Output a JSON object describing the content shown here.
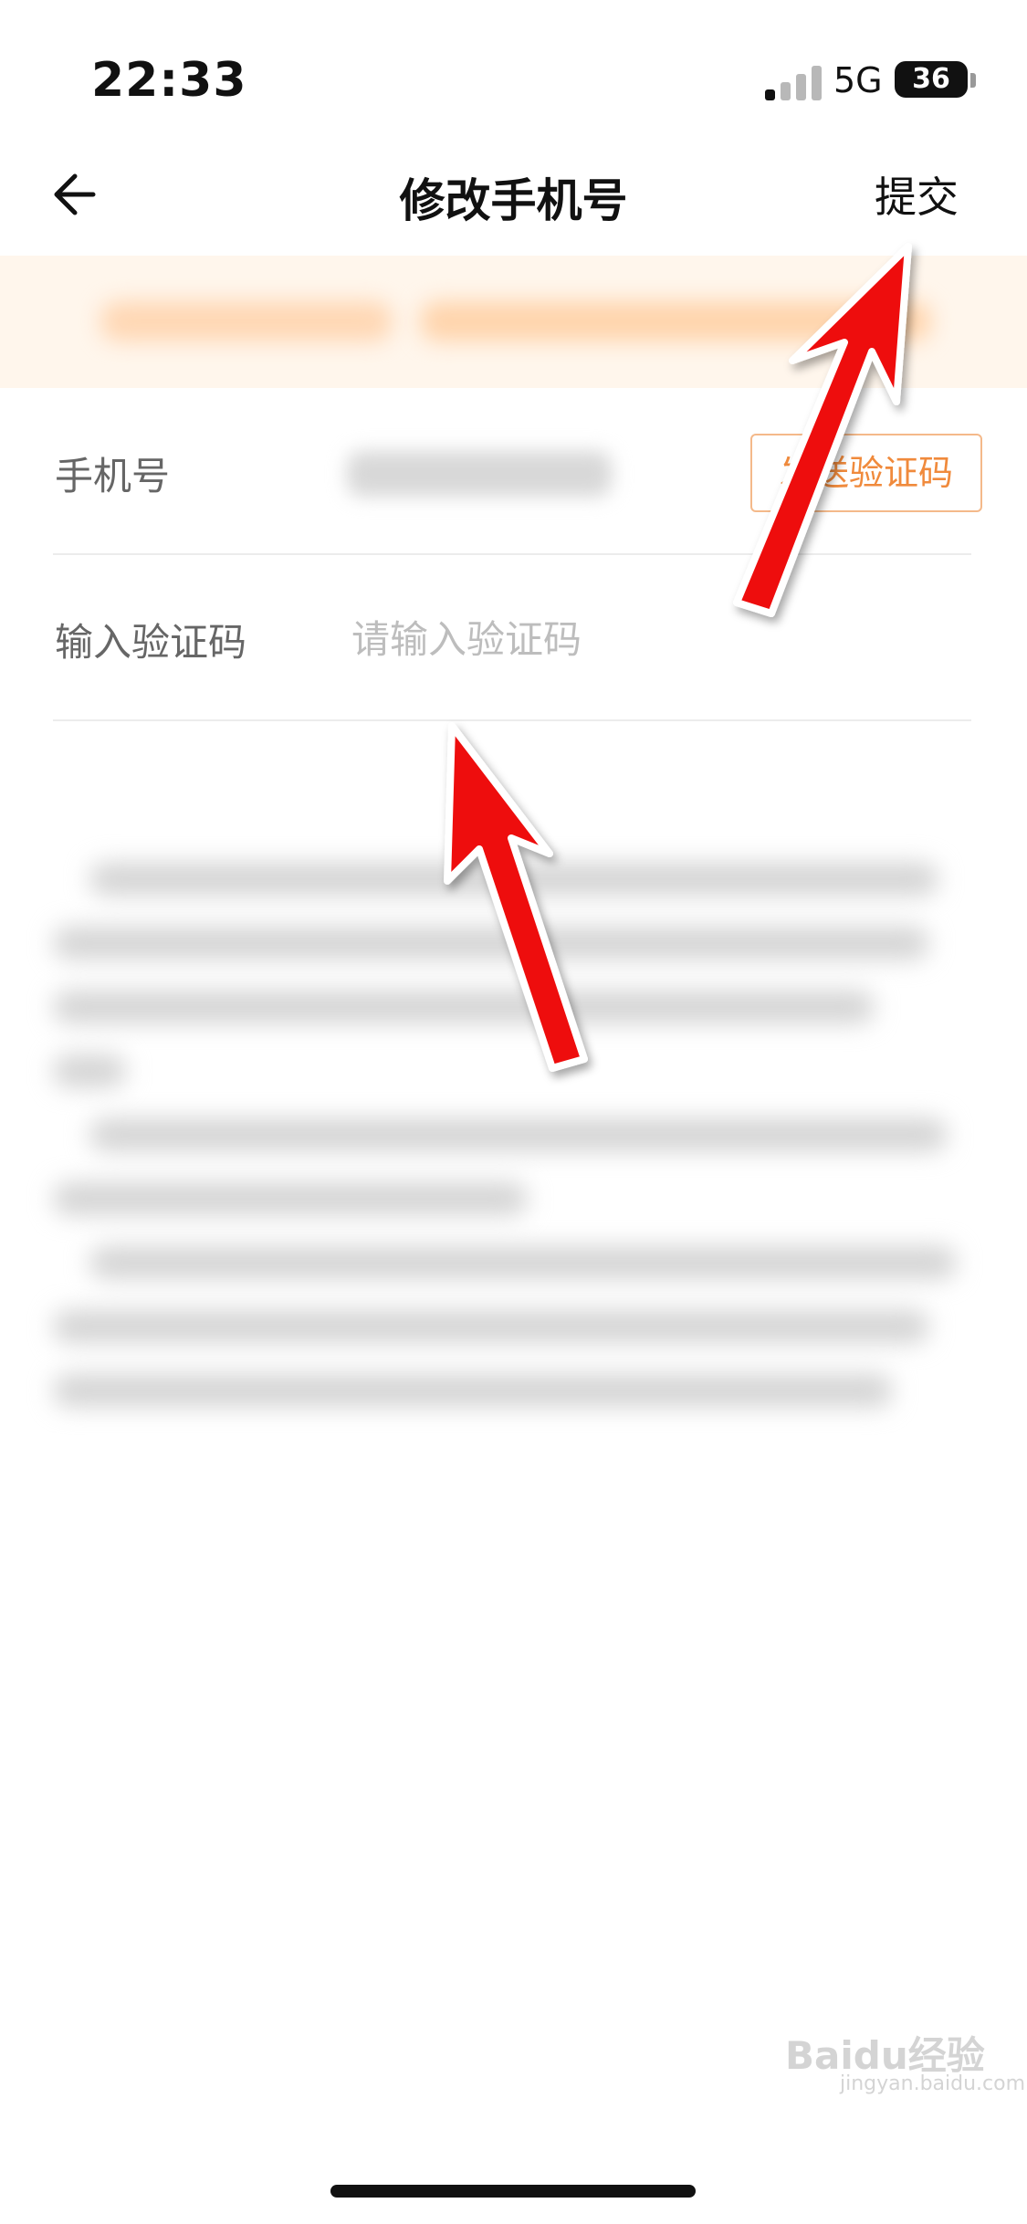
{
  "status_bar": {
    "time": "22:33",
    "network": "5G",
    "battery": "36"
  },
  "nav": {
    "title": "修改手机号",
    "submit_label": "提交",
    "back_icon": "arrow-left-icon"
  },
  "form": {
    "phone_label": "手机号",
    "send_code_label": "发送验证码",
    "code_label": "输入验证码",
    "code_placeholder": "请输入验证码"
  },
  "watermark": {
    "text": "Baidu经验",
    "url": "jingyan.baidu.com"
  },
  "colors": {
    "accent": "#f08a3c",
    "notice_bg": "#fff6ec",
    "annotation_arrow": "#ee1111"
  }
}
